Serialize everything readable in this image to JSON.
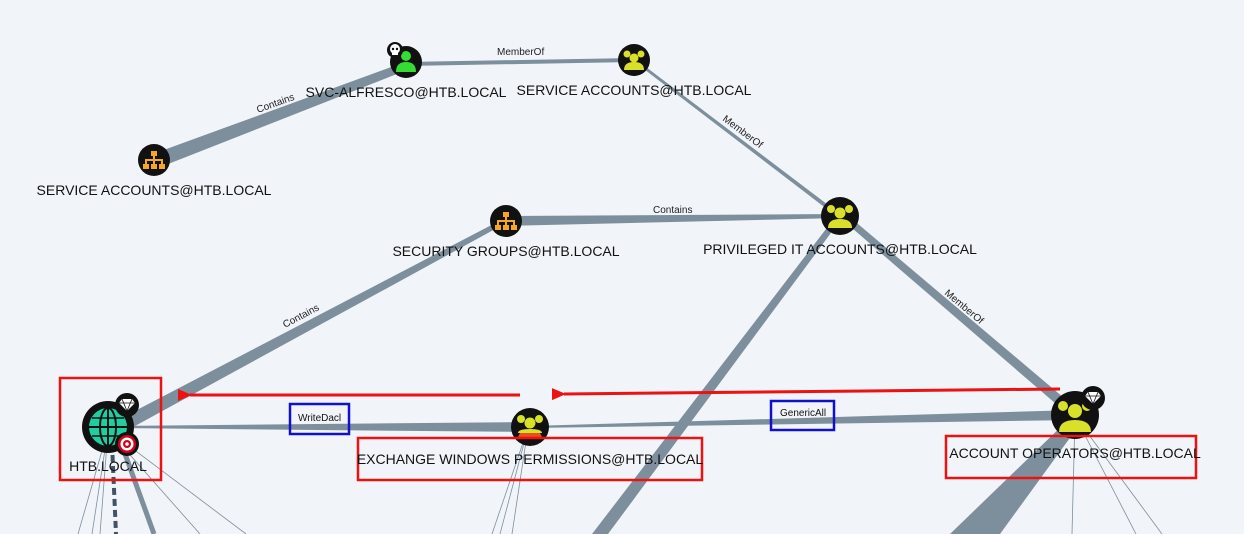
{
  "colors": {
    "background": "#f1f4f9",
    "edge": "#7d8f9c",
    "highlight_red": "#ee1111",
    "highlight_blue": "#1111cc",
    "group_icon": "#d9e02a",
    "ou_icon": "#f5a623",
    "domain_icon": "#1fcfa0",
    "user_icon": "#33dd33"
  },
  "nodes": {
    "svc_alfresco": {
      "label": "SVC-ALFRESCO@HTB.LOCAL",
      "icon": "user-icon",
      "badge": "skull-icon"
    },
    "service_accounts_group": {
      "label": "SERVICE ACCOUNTS@HTB.LOCAL",
      "icon": "group-icon"
    },
    "service_accounts_ou": {
      "label": "SERVICE ACCOUNTS@HTB.LOCAL",
      "icon": "ou-icon"
    },
    "security_groups_ou": {
      "label": "SECURITY GROUPS@HTB.LOCAL",
      "icon": "ou-icon"
    },
    "privileged_it": {
      "label": "PRIVILEGED IT ACCOUNTS@HTB.LOCAL",
      "icon": "group-icon"
    },
    "htb_local": {
      "label": "HTB.LOCAL",
      "icon": "globe-icon",
      "badges": [
        "diamond-icon",
        "target-icon"
      ]
    },
    "exchange_windows_permissions": {
      "label": "EXCHANGE WINDOWS PERMISSIONS@HTB.LOCAL",
      "icon": "group-icon"
    },
    "account_operators": {
      "label": "ACCOUNT OPERATORS@HTB.LOCAL",
      "icon": "group-icon",
      "badge": "diamond-icon"
    }
  },
  "edges": {
    "svc_memberof_service": "MemberOf",
    "ou_contains_svc": "Contains",
    "service_memberof_priv": "MemberOf",
    "secgroups_contains_priv": "Contains",
    "htb_contains_secgroups": "Contains",
    "priv_memberof_accountops": "MemberOf",
    "exchange_writedacl_htb": "WriteDacl",
    "accountops_genericall_exchange": "GenericAll"
  }
}
